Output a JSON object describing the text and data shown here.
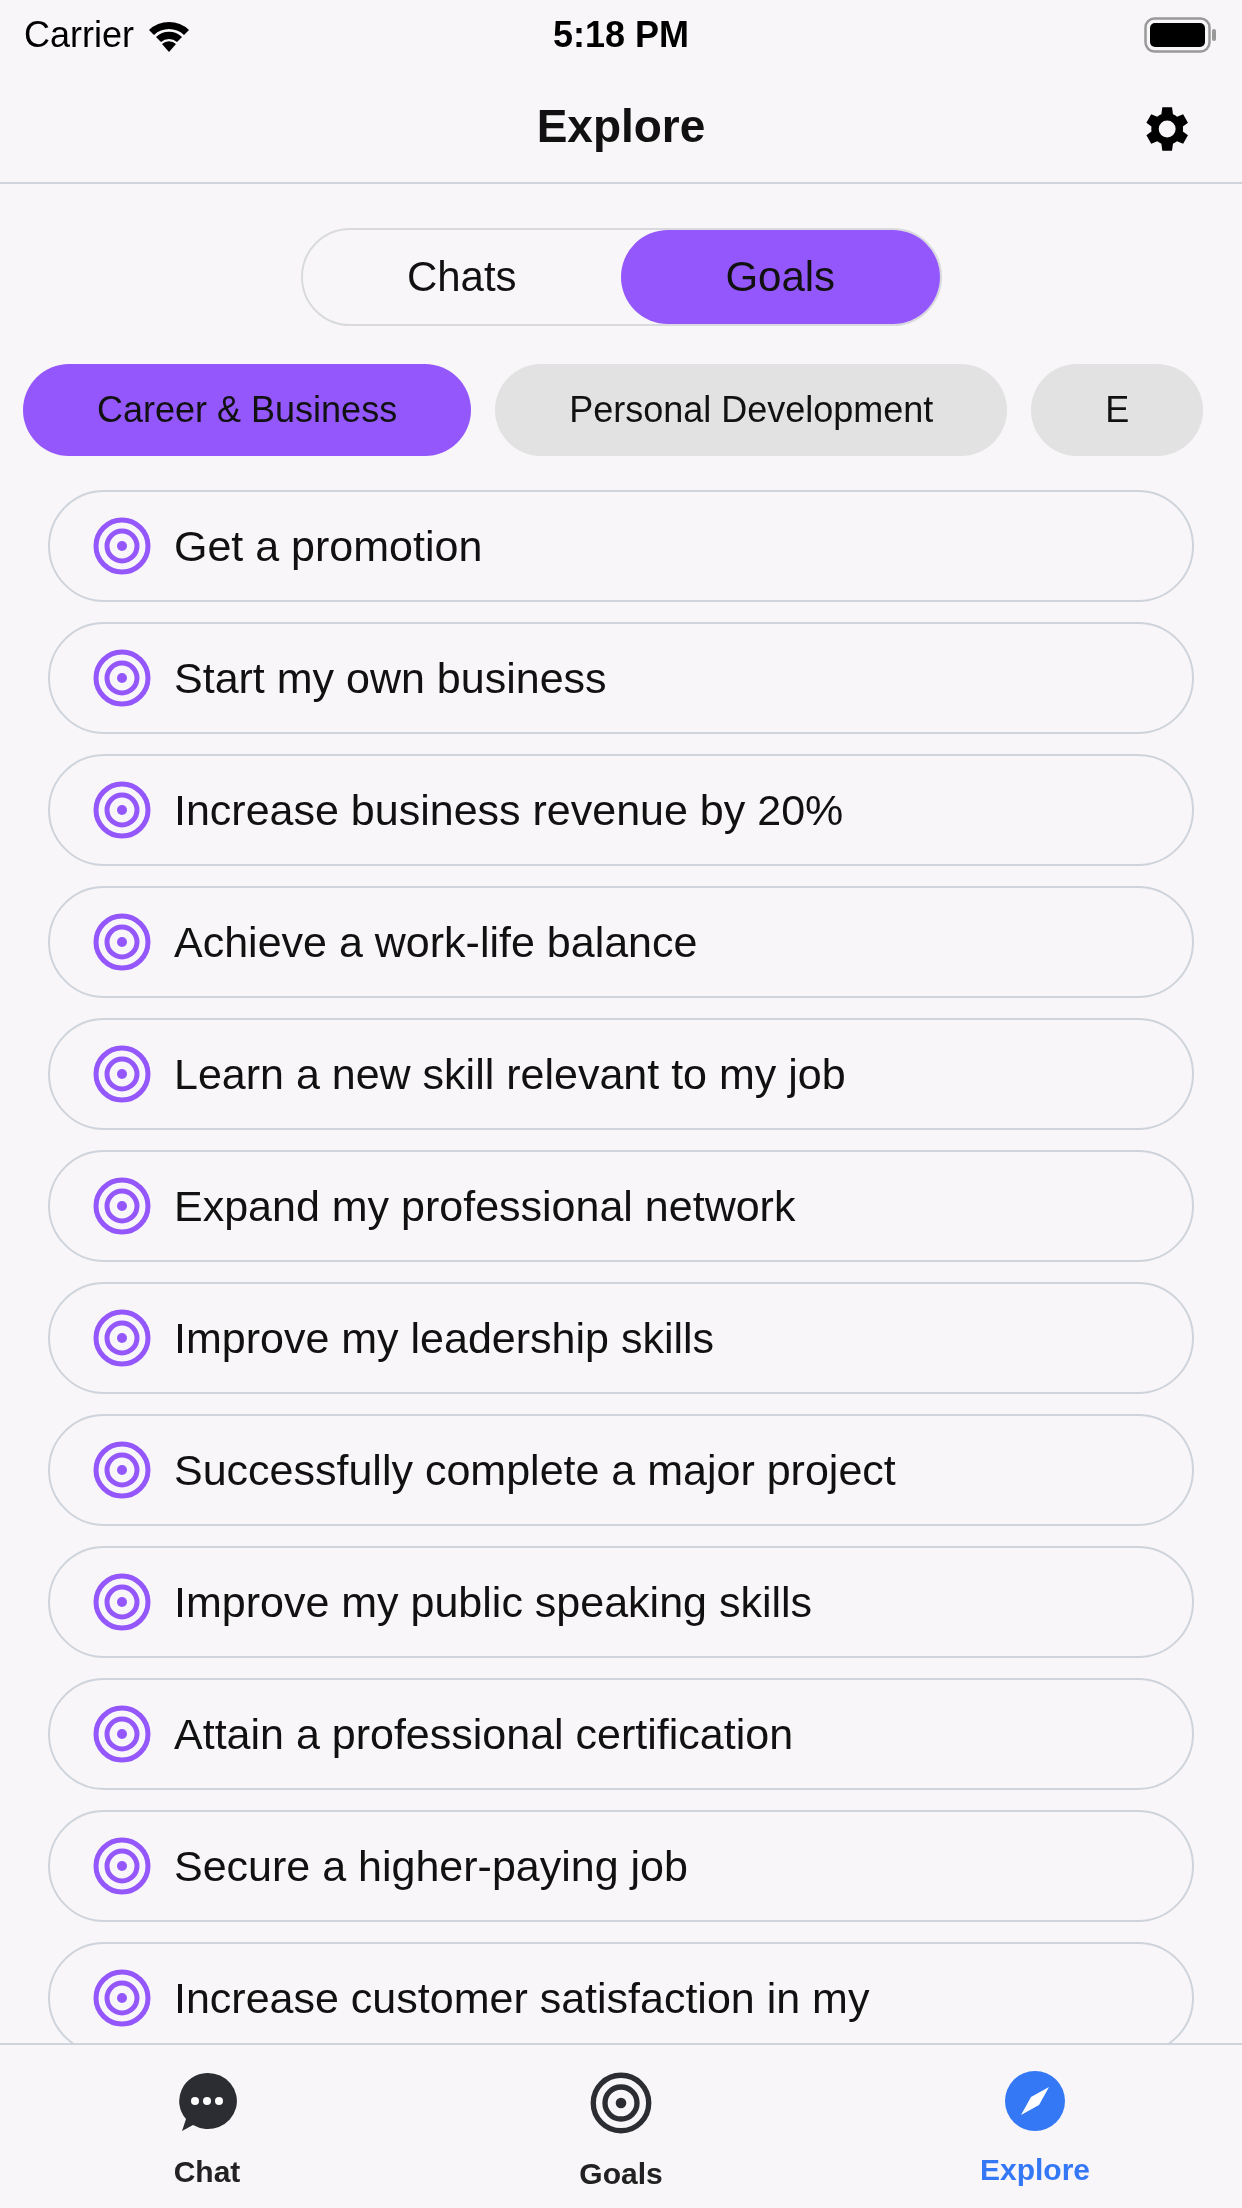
{
  "status_bar": {
    "carrier": "Carrier",
    "time": "5:18 PM"
  },
  "header": {
    "title": "Explore"
  },
  "segments": [
    {
      "label": "Chats",
      "selected": false
    },
    {
      "label": "Goals",
      "selected": true
    }
  ],
  "categories": [
    {
      "label": "Career & Business",
      "selected": true
    },
    {
      "label": "Personal Development",
      "selected": false
    },
    {
      "label": "E",
      "selected": false
    }
  ],
  "goals": [
    {
      "label": "Get a promotion"
    },
    {
      "label": "Start my own business"
    },
    {
      "label": "Increase business revenue by 20%"
    },
    {
      "label": "Achieve a work-life balance"
    },
    {
      "label": "Learn a new skill relevant to my job"
    },
    {
      "label": "Expand my professional network"
    },
    {
      "label": "Improve my leadership skills"
    },
    {
      "label": "Successfully complete a major project"
    },
    {
      "label": "Improve my public speaking skills"
    },
    {
      "label": "Attain a professional certification"
    },
    {
      "label": "Secure a higher-paying job"
    },
    {
      "label": "Increase customer satisfaction in my"
    }
  ],
  "tab_bar": [
    {
      "kind": "chat",
      "label": "Chat",
      "selected": false
    },
    {
      "kind": "goals",
      "label": "Goals",
      "selected": false
    },
    {
      "kind": "explore",
      "label": "Explore",
      "selected": true
    }
  ]
}
